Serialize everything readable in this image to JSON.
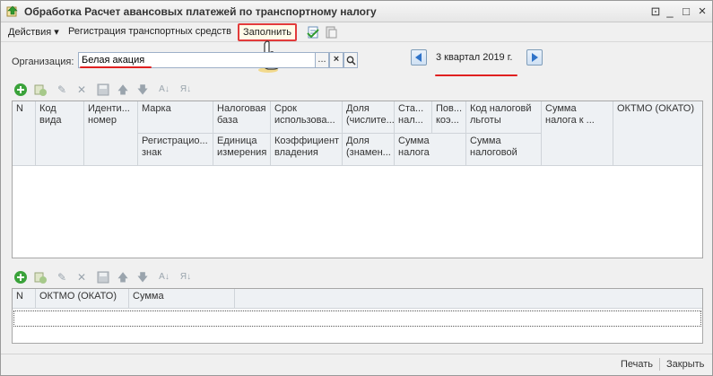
{
  "window": {
    "title": "Обработка  Расчет авансовых платежей по транспортному налогу",
    "controls": {
      "settings": "⊡",
      "minimize": "_",
      "maximize": "□",
      "close": "×"
    }
  },
  "toolbar": {
    "actions_label": "Действия ▾",
    "register_label": "Регистрация транспортных средств",
    "fill_label": "Заполнить"
  },
  "org": {
    "label": "Организация:",
    "value": "Белая акация",
    "select_btn": "...",
    "clear_btn": "×",
    "search_btn": "⌕"
  },
  "period": {
    "text": "3 квартал 2019 г."
  },
  "table1": {
    "columns_top": [
      "N",
      "Код вида",
      "Иденти... номер",
      "Марка",
      "Налоговая база",
      "Срок использова...",
      "Доля (числите...",
      "Ста... нал...",
      "Пов... коэ...",
      "Код налоговй льготы",
      "Сумма налога к ...",
      "ОКТМО (ОКАТО)"
    ],
    "columns_bottom": [
      "Регистрацио... знак",
      "Единица измерения",
      "Коэффициент владения",
      "Доля (знамен...",
      "Сумма налога",
      "Сумма налоговой"
    ]
  },
  "table2": {
    "columns": [
      "N",
      "ОКТМО (ОКАТО)",
      "Сумма"
    ]
  },
  "footer": {
    "print_label": "Печать",
    "close_label": "Закрыть"
  },
  "colors": {
    "highlight_red": "#e23b3b",
    "arrow_blue": "#2f73c9",
    "add_green": "#3aa23a"
  }
}
